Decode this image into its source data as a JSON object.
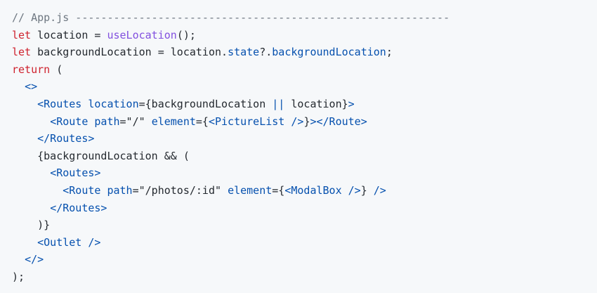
{
  "code": {
    "colors": {
      "background": "#f6f8fa",
      "comment": "#6e7781",
      "keyword": "#cf222e",
      "function": "#8250df",
      "plain": "#24292f",
      "blue": "#0550ae"
    },
    "lines": [
      {
        "indent": "",
        "tokens": [
          {
            "t": "// App.js -----------------------------------------------------------",
            "c": "comment"
          }
        ]
      },
      {
        "indent": "",
        "tokens": [
          {
            "t": "let",
            "c": "keyword"
          },
          {
            "t": " location = ",
            "c": "plain"
          },
          {
            "t": "useLocation",
            "c": "func"
          },
          {
            "t": "();",
            "c": "plain"
          }
        ]
      },
      {
        "indent": "",
        "tokens": [
          {
            "t": "let",
            "c": "keyword"
          },
          {
            "t": " backgroundLocation = location.",
            "c": "plain"
          },
          {
            "t": "state",
            "c": "prop"
          },
          {
            "t": "?.",
            "c": "plain"
          },
          {
            "t": "backgroundLocation",
            "c": "prop"
          },
          {
            "t": ";",
            "c": "plain"
          }
        ]
      },
      {
        "indent": "",
        "tokens": [
          {
            "t": "return",
            "c": "keyword"
          },
          {
            "t": " (",
            "c": "plain"
          }
        ]
      },
      {
        "indent": "  ",
        "tokens": [
          {
            "t": "<>",
            "c": "blue"
          }
        ]
      },
      {
        "indent": "    ",
        "tokens": [
          {
            "t": "<Routes",
            "c": "blue"
          },
          {
            "t": " location",
            "c": "blue"
          },
          {
            "t": "={backgroundLocation ",
            "c": "plain"
          },
          {
            "t": "||",
            "c": "blue"
          },
          {
            "t": " location}",
            "c": "plain"
          },
          {
            "t": ">",
            "c": "blue"
          }
        ]
      },
      {
        "indent": "      ",
        "tokens": [
          {
            "t": "<Route",
            "c": "blue"
          },
          {
            "t": " path",
            "c": "blue"
          },
          {
            "t": "=\"/\" ",
            "c": "plain"
          },
          {
            "t": "element",
            "c": "blue"
          },
          {
            "t": "={",
            "c": "plain"
          },
          {
            "t": "<PictureList />",
            "c": "blue"
          },
          {
            "t": "}",
            "c": "plain"
          },
          {
            "t": "></Route>",
            "c": "blue"
          }
        ]
      },
      {
        "indent": "    ",
        "tokens": [
          {
            "t": "</Routes>",
            "c": "blue"
          }
        ]
      },
      {
        "indent": "    ",
        "tokens": [
          {
            "t": "{backgroundLocation && (",
            "c": "plain"
          }
        ]
      },
      {
        "indent": "      ",
        "tokens": [
          {
            "t": "<Routes>",
            "c": "blue"
          }
        ]
      },
      {
        "indent": "        ",
        "tokens": [
          {
            "t": "<Route",
            "c": "blue"
          },
          {
            "t": " path",
            "c": "blue"
          },
          {
            "t": "=\"/photos/:id\" ",
            "c": "plain"
          },
          {
            "t": "element",
            "c": "blue"
          },
          {
            "t": "={",
            "c": "plain"
          },
          {
            "t": "<ModalBox />",
            "c": "blue"
          },
          {
            "t": "} ",
            "c": "plain"
          },
          {
            "t": "/>",
            "c": "blue"
          }
        ]
      },
      {
        "indent": "      ",
        "tokens": [
          {
            "t": "</Routes>",
            "c": "blue"
          }
        ]
      },
      {
        "indent": "    ",
        "tokens": [
          {
            "t": ")}",
            "c": "plain"
          }
        ]
      },
      {
        "indent": "    ",
        "tokens": [
          {
            "t": "<Outlet />",
            "c": "blue"
          }
        ]
      },
      {
        "indent": "  ",
        "tokens": [
          {
            "t": "</>",
            "c": "blue"
          }
        ]
      },
      {
        "indent": "",
        "tokens": [
          {
            "t": ");",
            "c": "plain"
          }
        ]
      }
    ]
  }
}
